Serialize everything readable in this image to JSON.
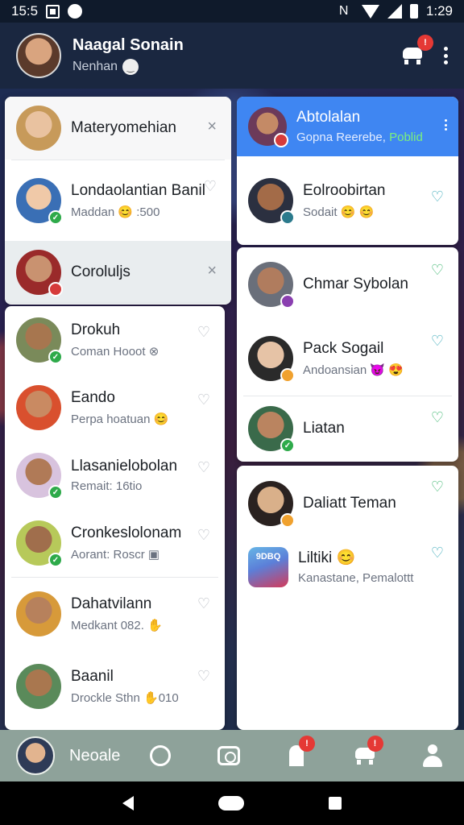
{
  "status_bar": {
    "time": "15:5",
    "time_right": "1:29"
  },
  "header": {
    "name": "Naagal Sonain",
    "status": "Nenhan",
    "notification_badge": "!"
  },
  "left_panel": {
    "items": [
      {
        "title": "Materyomehian",
        "subtitle": "",
        "action": "×",
        "avatar": "av1"
      },
      {
        "title": "Londaolantian Banil",
        "subtitle": "Maddan 😊 :500",
        "action": "♡",
        "avatar": "av2"
      },
      {
        "title": "Coroluljs",
        "subtitle": "",
        "action": "×",
        "avatar": "av3"
      },
      {
        "title": "Drokuh",
        "subtitle": "Coman Hooot ⊗",
        "action": "♡",
        "avatar": "av4"
      },
      {
        "title": "Eando",
        "subtitle": "Perpa hoatuan 😊",
        "action": "♡",
        "avatar": "av5"
      },
      {
        "title": "Llasanielobolan",
        "subtitle": "Remait: 16tio",
        "action": "♡",
        "avatar": "av6"
      },
      {
        "title": "Cronkeslolonam",
        "subtitle": "Aorant: Roscr ▣",
        "action": "♡",
        "avatar": "av7"
      },
      {
        "title": "Dahatvilann",
        "subtitle": "Medkant 082. ✋",
        "action": "♡",
        "avatar": "av8"
      },
      {
        "title": "Baanil",
        "subtitle": "Drockle Sthn ✋010",
        "action": "♡",
        "avatar": "av9"
      }
    ]
  },
  "right_panel": {
    "header": {
      "title": "Abtolalan",
      "subtitle": "Gopna Reerebe,",
      "tag": "Poblid"
    },
    "items": [
      {
        "title": "Eolroobirtan",
        "subtitle": "Sodait 😊 😊",
        "action": "♡"
      },
      {
        "title": "Chmar Sybolan",
        "subtitle": "",
        "action": "♡"
      },
      {
        "title": "Pack Sogail",
        "subtitle": "Andoansian 😈 😍",
        "action": "♡"
      },
      {
        "title": "Liatan",
        "subtitle": "",
        "action": "♡"
      },
      {
        "title": "Daliatt Teman",
        "subtitle": "",
        "action": "♡"
      },
      {
        "title": "Liltiki 😊",
        "subtitle": "Kanastane, Pemalottt",
        "action": "♡",
        "thumb_text": "9DBQ"
      }
    ]
  },
  "bottom_nav": {
    "label": "Neoale",
    "badge_1": "!",
    "badge_2": "!"
  },
  "colors": {
    "accent_blue": "#3f86f2",
    "bottom_nav": "#8ea29a",
    "header_bg": "#1a2740"
  }
}
